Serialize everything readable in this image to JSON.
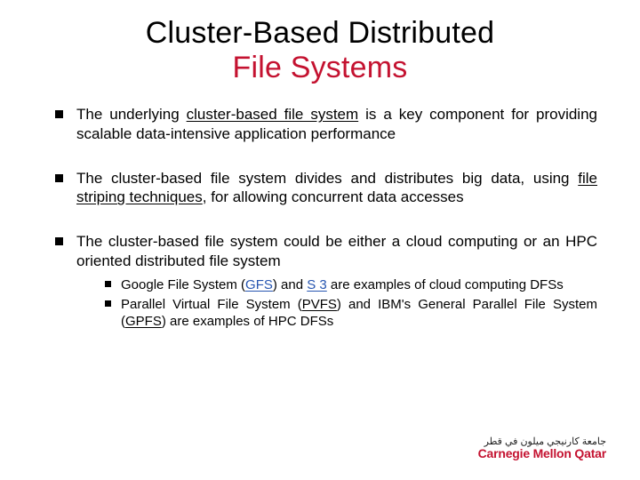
{
  "title": {
    "line1": "Cluster-Based Distributed",
    "line2": "File Systems"
  },
  "bullets": [
    {
      "pre": "The underlying ",
      "u1": "cluster-based file system",
      "post": " is a key component for providing scalable data-intensive application performance"
    },
    {
      "pre": "The cluster-based file system divides and distributes big data, using ",
      "u1": "file striping techniques",
      "post": ", for allowing concurrent data accesses"
    },
    {
      "pre": "The cluster-based file system could be either a cloud computing or an HPC oriented distributed file system",
      "sub": [
        {
          "t1": "Google File System (",
          "b1": "GFS",
          "t2": ") and ",
          "b2": "S 3",
          "t3": " are examples of cloud computing DFSs"
        },
        {
          "t1": "Parallel Virtual File System (",
          "b1": "PVFS",
          "t2": ") and IBM's General Parallel File System (",
          "b2": "GPFS",
          "t3": ") are examples of HPC DFSs"
        }
      ]
    }
  ],
  "logo": {
    "arabic": "جامعة كارنيجي ميلون في قطر",
    "english": "Carnegie Mellon Qatar"
  },
  "colors": {
    "accent": "#c41230",
    "link": "#2655b0"
  }
}
